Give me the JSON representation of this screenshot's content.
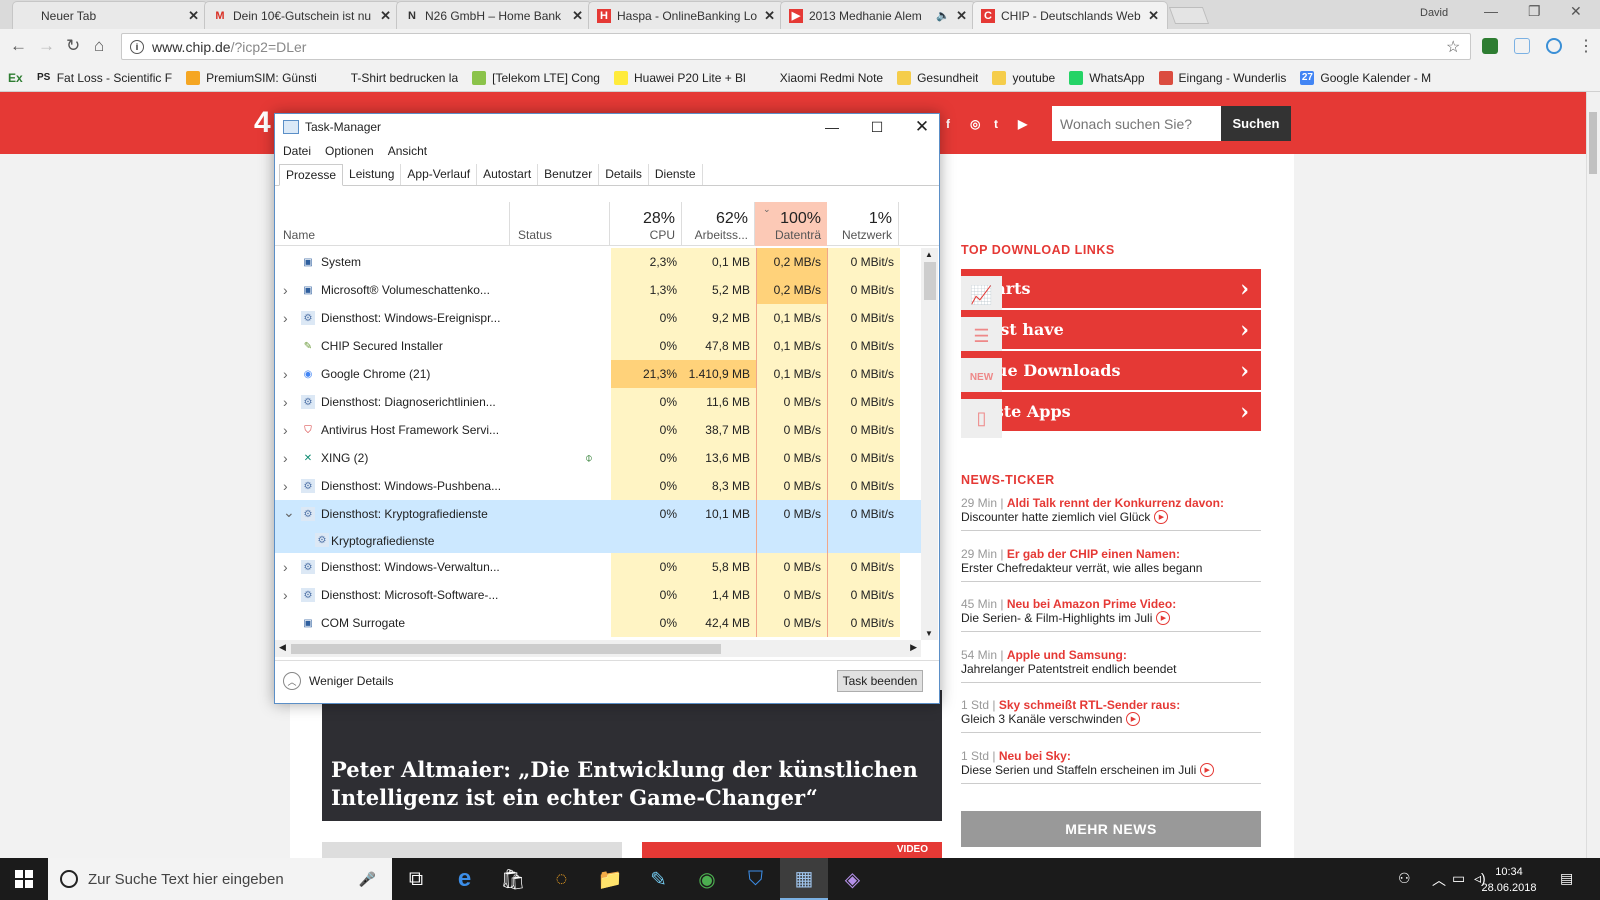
{
  "browser": {
    "tabs": [
      {
        "title": "Neuer Tab",
        "icon": "blank"
      },
      {
        "title": "Dein 10€-Gutschein ist nu",
        "icon": "gmail"
      },
      {
        "title": "N26 GmbH – Home Bank",
        "icon": "n26"
      },
      {
        "title": "Haspa - OnlineBanking Lo",
        "icon": "haspa"
      },
      {
        "title": "2013 Medhanie Alem",
        "icon": "youtube"
      },
      {
        "title": "CHIP - Deutschlands Web",
        "icon": "chip"
      }
    ],
    "user": "David",
    "url_host": "www.chip.de",
    "url_query": "/?icp2=DLer",
    "bookmarks": [
      {
        "label": "Ex",
        "icon": "ex"
      },
      {
        "label": "Fat Loss - Scientific F",
        "icon": "ps"
      },
      {
        "label": "PremiumSIM: Günsti",
        "icon": "sim"
      },
      {
        "label": "T-Shirt bedrucken la",
        "icon": "shirt"
      },
      {
        "label": "[Telekom LTE] Cong",
        "icon": "android"
      },
      {
        "label": "Huawei P20 Lite + Bl",
        "icon": "huawei"
      },
      {
        "label": "Xiaomi Redmi Note",
        "icon": "xiaomi"
      },
      {
        "label": "Gesundheit",
        "icon": "folder"
      },
      {
        "label": "youtube",
        "icon": "folder"
      },
      {
        "label": "WhatsApp",
        "icon": "whatsapp"
      },
      {
        "label": "Eingang - Wunderlis",
        "icon": "wunderlist"
      },
      {
        "label": "Google Kalender - M",
        "icon": "calendar"
      }
    ]
  },
  "page": {
    "logo_fragment": "4",
    "search_placeholder": "Wonach suchen Sie?",
    "search_button": "Suchen",
    "top_downloads_heading": "TOP DOWNLOAD LINKS",
    "downloads": [
      "Charts",
      "Must have",
      "Neue Downloads",
      "Beste Apps"
    ],
    "news_heading": "NEWS-TICKER",
    "news": [
      {
        "time": "29 Min |",
        "headline": "Aldi Talk rennt der Konkurrenz davon:",
        "teaser": "Discounter hatte ziemlich viel Glück"
      },
      {
        "time": "29 Min |",
        "headline": "Er gab der CHIP einen Namen:",
        "teaser": "Erster Chefredakteur verrät, wie alles begann"
      },
      {
        "time": "45 Min |",
        "headline": "Neu bei Amazon Prime Video:",
        "teaser": "Die Serien- & Film-Highlights im Juli"
      },
      {
        "time": "54 Min |",
        "headline": "Apple und Samsung:",
        "teaser": "Jahrelanger Patentstreit endlich beendet"
      },
      {
        "time": "1 Std |",
        "headline": "Sky schmeißt RTL-Sender raus:",
        "teaser": "Gleich 3 Kanäle verschwinden"
      },
      {
        "time": "1 Std |",
        "headline": "Neu bei Sky:",
        "teaser": "Diese Serien und Staffeln erscheinen im Juli"
      }
    ],
    "more_news": "MEHR NEWS",
    "hero_title": "Peter Altmaier: „Die Entwicklung der künstlichen Intelligenz ist ein echter Game-Changer“",
    "video_badge": "VIDEO"
  },
  "taskmanager": {
    "title": "Task-Manager",
    "menu": [
      "Datei",
      "Optionen",
      "Ansicht"
    ],
    "tabs": [
      "Prozesse",
      "Leistung",
      "App-Verlauf",
      "Autostart",
      "Benutzer",
      "Details",
      "Dienste"
    ],
    "columns": {
      "name": "Name",
      "status": "Status",
      "cpu_pct": "28%",
      "cpu": "CPU",
      "mem_pct": "62%",
      "mem": "Arbeitss...",
      "disk_pct": "100%",
      "disk": "Datenträ",
      "net_pct": "1%",
      "net": "Netzwerk"
    },
    "rows": [
      {
        "name": "System",
        "cpu": "2,3%",
        "mem": "0,1 MB",
        "disk": "0,2 MB/s",
        "net": "0 MBit/s",
        "expand": "",
        "icon": "system"
      },
      {
        "name": "Microsoft® Volumeschattenko...",
        "cpu": "1,3%",
        "mem": "5,2 MB",
        "disk": "0,2 MB/s",
        "net": "0 MBit/s",
        "expand": ">",
        "icon": "system"
      },
      {
        "name": "Diensthost: Windows-Ereignispr...",
        "cpu": "0%",
        "mem": "9,2 MB",
        "disk": "0,1 MB/s",
        "net": "0 MBit/s",
        "expand": ">",
        "icon": "gear"
      },
      {
        "name": "CHIP Secured Installer",
        "cpu": "0%",
        "mem": "47,8 MB",
        "disk": "0,1 MB/s",
        "net": "0 MBit/s",
        "expand": "",
        "icon": "installer"
      },
      {
        "name": "Google Chrome (21)",
        "cpu": "21,3%",
        "mem": "1.410,9 MB",
        "disk": "0,1 MB/s",
        "net": "0 MBit/s",
        "expand": ">",
        "icon": "chrome"
      },
      {
        "name": "Diensthost: Diagnoserichtlinien...",
        "cpu": "0%",
        "mem": "11,6 MB",
        "disk": "0 MB/s",
        "net": "0 MBit/s",
        "expand": ">",
        "icon": "gear"
      },
      {
        "name": "Antivirus Host Framework Servi...",
        "cpu": "0%",
        "mem": "38,7 MB",
        "disk": "0 MB/s",
        "net": "0 MBit/s",
        "expand": ">",
        "icon": "antivirus"
      },
      {
        "name": "XING (2)",
        "cpu": "0%",
        "mem": "13,6 MB",
        "disk": "0 MB/s",
        "net": "0 MBit/s",
        "expand": ">",
        "icon": "xing"
      },
      {
        "name": "Diensthost: Windows-Pushbena...",
        "cpu": "0%",
        "mem": "8,3 MB",
        "disk": "0 MB/s",
        "net": "0 MBit/s",
        "expand": ">",
        "icon": "gear"
      },
      {
        "name": "Diensthost: Kryptografiedienste",
        "cpu": "0%",
        "mem": "10,1 MB",
        "disk": "0 MB/s",
        "net": "0 MBit/s",
        "expand": "v",
        "icon": "gear"
      },
      {
        "name": "Kryptografiedienste",
        "cpu": "",
        "mem": "",
        "disk": "",
        "net": "",
        "expand": "",
        "icon": "gear"
      },
      {
        "name": "Diensthost: Windows-Verwaltun...",
        "cpu": "0%",
        "mem": "5,8 MB",
        "disk": "0 MB/s",
        "net": "0 MBit/s",
        "expand": ">",
        "icon": "gear"
      },
      {
        "name": "Diensthost: Microsoft-Software-...",
        "cpu": "0%",
        "mem": "1,4 MB",
        "disk": "0 MB/s",
        "net": "0 MBit/s",
        "expand": ">",
        "icon": "gear"
      },
      {
        "name": "COM Surrogate",
        "cpu": "0%",
        "mem": "42,4 MB",
        "disk": "0 MB/s",
        "net": "0 MBit/s",
        "expand": "",
        "icon": "system"
      }
    ],
    "fewer_details": "Weniger Details",
    "end_task": "Task beenden",
    "colors": {
      "cpu_low": "#fff4c4",
      "cpu_high": "#ffd27a",
      "disk_hot": "#ffd27a",
      "selected": "#cce8ff",
      "disk_header": "#fcc9b6"
    }
  },
  "taskbar": {
    "search_placeholder": "Zur Suche Text hier eingeben",
    "apps": [
      "task-view",
      "edge",
      "store",
      "ubuntu-launcher",
      "explorer",
      "notepad",
      "chrome",
      "defender",
      "taskmanager",
      "visual-studio"
    ],
    "time": "10:34",
    "date": "28.06.2018"
  }
}
